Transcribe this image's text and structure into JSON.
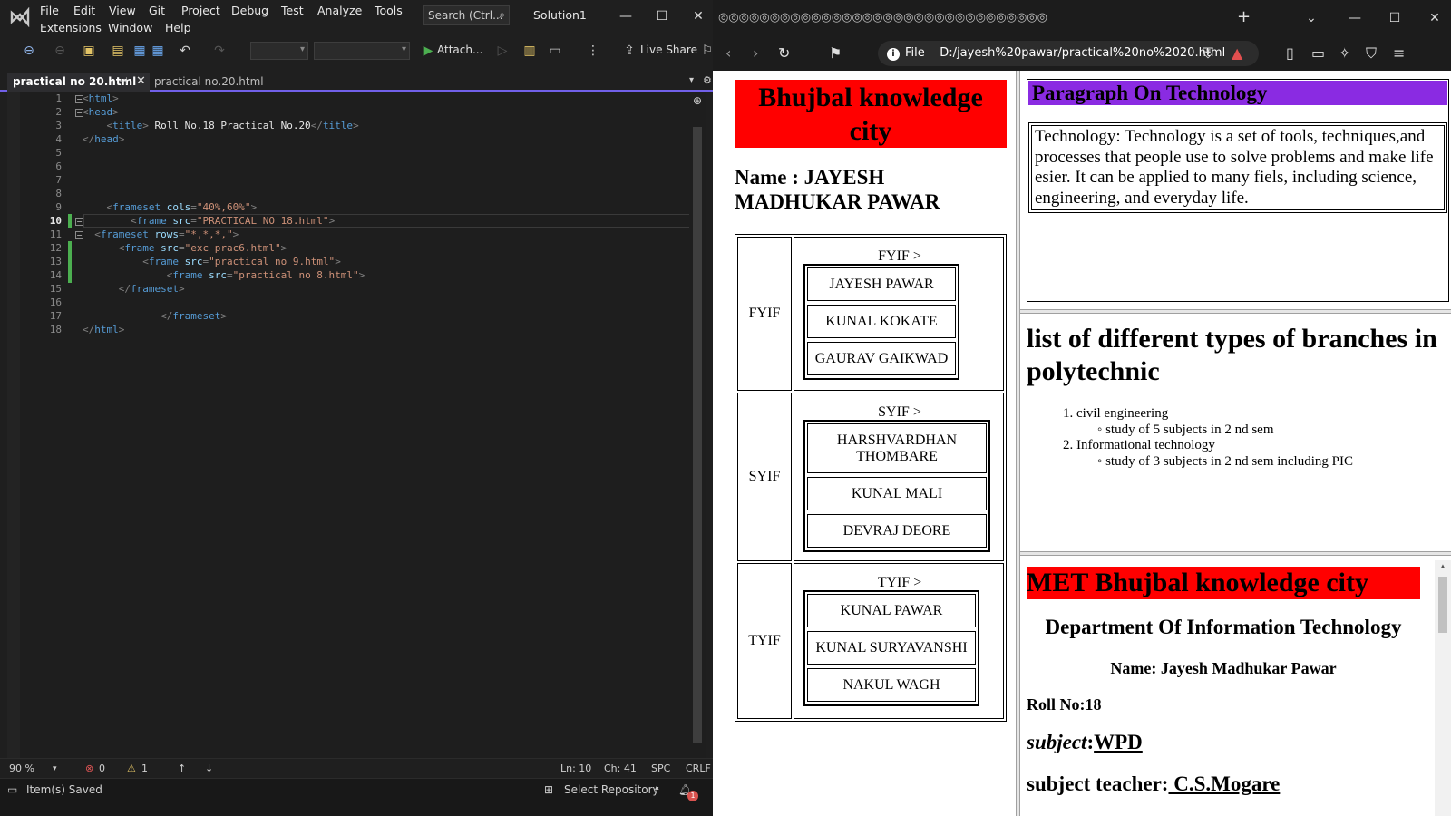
{
  "vs": {
    "menu": [
      "File",
      "Edit",
      "View",
      "Git",
      "Project",
      "Debug",
      "Test",
      "Analyze",
      "Tools"
    ],
    "menu2": [
      "Extensions",
      "Window",
      "Help"
    ],
    "search_label": "Search (Ctrl...",
    "solution": "Solution1",
    "toolbar": {
      "attach": "Attach...",
      "live_share": "Live Share"
    },
    "tabs": [
      {
        "label": "practical no 20.html",
        "active": true
      },
      {
        "label": "practical no.20.html",
        "active": false
      }
    ],
    "line_numbers": [
      "1",
      "2",
      "3",
      "4",
      "5",
      "6",
      "7",
      "8",
      "9",
      "10",
      "11",
      "12",
      "13",
      "14",
      "15",
      "16",
      "17",
      "18"
    ],
    "current_line": "10",
    "code": {
      "l1": {
        "open": "<",
        "tag": "html",
        "close": ">"
      },
      "l2": {
        "open": "<",
        "tag": "head",
        "close": ">"
      },
      "l3": {
        "indent": "    ",
        "open": "<",
        "tag": "title",
        "close": ">",
        "text": " Roll No.18 Practical No.20",
        "etag_open": "</",
        "etag": "title",
        "etag_close": ">"
      },
      "l4": {
        "open": "</",
        "tag": "head",
        "close": ">"
      },
      "l9": {
        "indent": "    ",
        "open": "<",
        "tag": "frameset",
        "attr": " cols",
        "eq": "=",
        "val": "\"40%,60%\"",
        "close": ">"
      },
      "l10": {
        "indent": "        ",
        "open": "<",
        "tag": "frame",
        "attr": " src",
        "eq": "=",
        "val": "\"PRACTICAL NO 18.html\"",
        "close": ">"
      },
      "l11": {
        "indent": "  ",
        "open": "<",
        "tag": "frameset",
        "attr": " rows",
        "eq": "=",
        "val": "\"*,*,*,\"",
        "close": ">"
      },
      "l12": {
        "indent": "      ",
        "open": "<",
        "tag": "frame",
        "attr": " src",
        "eq": "=",
        "val": "\"exc prac6.html\"",
        "close": ">"
      },
      "l13": {
        "indent": "          ",
        "open": "<",
        "tag": "frame",
        "attr": " src",
        "eq": "=",
        "val": "\"practical no 9.html\"",
        "close": ">"
      },
      "l14": {
        "indent": "              ",
        "open": "<",
        "tag": "frame",
        "attr": " src",
        "eq": "=",
        "val": "\"practical no 8.html\"",
        "close": ">"
      },
      "l15": {
        "indent": "      ",
        "open": "</",
        "tag": "frameset",
        "close": ">"
      },
      "l17": {
        "indent": "             ",
        "open": "</",
        "tag": "frameset",
        "close": ">"
      },
      "l18": {
        "open": "</",
        "tag": "html",
        "close": ">"
      }
    },
    "status": {
      "zoom": "90 %",
      "errors": "0",
      "warnings": "1",
      "ln": "Ln: 10",
      "ch": "Ch: 41",
      "spc": "SPC",
      "crlf": "CRLF",
      "saved": "Item(s) Saved",
      "repo": "Select Repository",
      "notif": "1"
    }
  },
  "browser": {
    "address_prefix": "File",
    "address": "D:/jayesh%20pawar/practical%20no%2020.html",
    "frame1": {
      "heading": "Bhujbal knowledge city",
      "name": "Name : JAYESH MADHUKAR PAWAR",
      "rows": [
        {
          "label": "FYIF",
          "caption": "FYIF >",
          "names": [
            "JAYESH PAWAR",
            "KUNAL KOKATE",
            "GAURAV GAIKWAD"
          ]
        },
        {
          "label": "SYIF",
          "caption": "SYIF >",
          "names": [
            "HARSHVARDHAN THOMBARE",
            "KUNAL MALI",
            "DEVRAJ DEORE"
          ]
        },
        {
          "label": "TYIF",
          "caption": "TYIF >",
          "names": [
            "KUNAL PAWAR",
            "KUNAL SURYAVANSHI",
            "NAKUL WAGH"
          ]
        }
      ]
    },
    "frame2": {
      "heading": "Paragraph On Technology",
      "paragraph": "Technology: Technology is a set of tools, techniques,and processes that people use to solve problems and make life esier. It can be applied to many fiels, including science, engineering, and everyday life."
    },
    "frame3": {
      "heading": "list of different types of branches in polytechnic",
      "items": [
        {
          "num": "1.",
          "label": "civil engineering",
          "sub": "study of 5 subjects in 2 nd sem"
        },
        {
          "num": "2.",
          "label": "Informational technology",
          "sub": "study of 3 subjects in 2 nd sem including PIC"
        }
      ]
    },
    "frame4": {
      "heading": "MET Bhujbal knowledge city",
      "dept": "Department Of Information Technology",
      "name": "Name: Jayesh Madhukar Pawar",
      "roll": "Roll No:18",
      "subject_label": "subject",
      "subject_sep": ":",
      "subject_value": "WPD",
      "teacher_label": "subject teacher:",
      "teacher_value": " C.S.Mogare"
    }
  },
  "colors": {
    "vs_bg": "#1f1f1f",
    "tag": "#569cd6",
    "attr": "#9cdcfe",
    "value": "#ce9178",
    "red_heading": "#ff0000",
    "purple_heading": "#8a2be2",
    "tab_underline": "#7160e8"
  }
}
